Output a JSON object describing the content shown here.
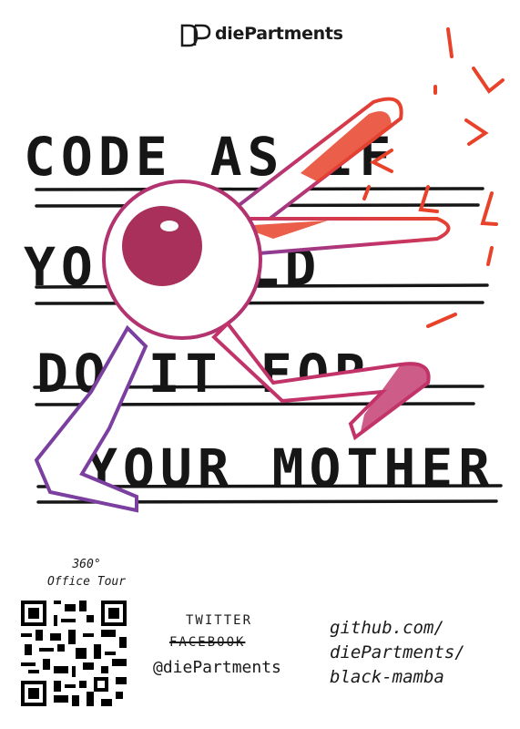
{
  "brand": {
    "name": "diePartments"
  },
  "headline": {
    "line1": "CODE AS  IF",
    "line2": "YO     WOULD",
    "line3": "DO  IT  FOR",
    "line4": "YOUR MOTHER"
  },
  "footer": {
    "tour_label": [
      "360°",
      "Office Tour"
    ],
    "twitter": "TWITTER",
    "facebook": "FACEBOOK",
    "handle": "@diePartments",
    "github": [
      "github.com/",
      "diePartments/",
      "black-mamba"
    ]
  },
  "colors": {
    "ink": "#161616",
    "accent_red": "#e8432a",
    "accent_purple": "#7b3fa0",
    "accent_magenta": "#c2336a"
  }
}
